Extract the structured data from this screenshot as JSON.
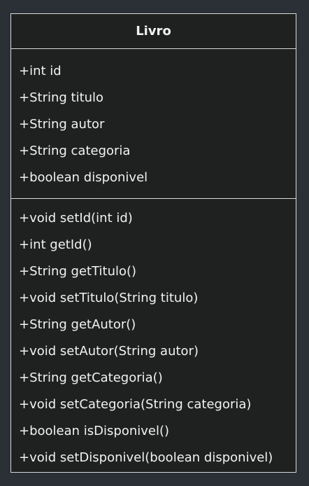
{
  "class": {
    "name": "Livro",
    "attributes": [
      "+int id",
      "+String titulo",
      "+String autor",
      "+String categoria",
      "+boolean disponivel"
    ],
    "methods": [
      "+void setId(int id)",
      "+int getId()",
      "+String getTitulo()",
      "+void setTitulo(String titulo)",
      "+String getAutor()",
      "+void setAutor(String autor)",
      "+String getCategoria()",
      "+void setCategoria(String categoria)",
      "+boolean isDisponivel()",
      "+void setDisponivel(boolean disponivel)"
    ]
  },
  "colors": {
    "background": "#2b2f36",
    "box_fill": "#1f2020",
    "border": "#d9d9d9",
    "text": "#f2f2f2"
  }
}
